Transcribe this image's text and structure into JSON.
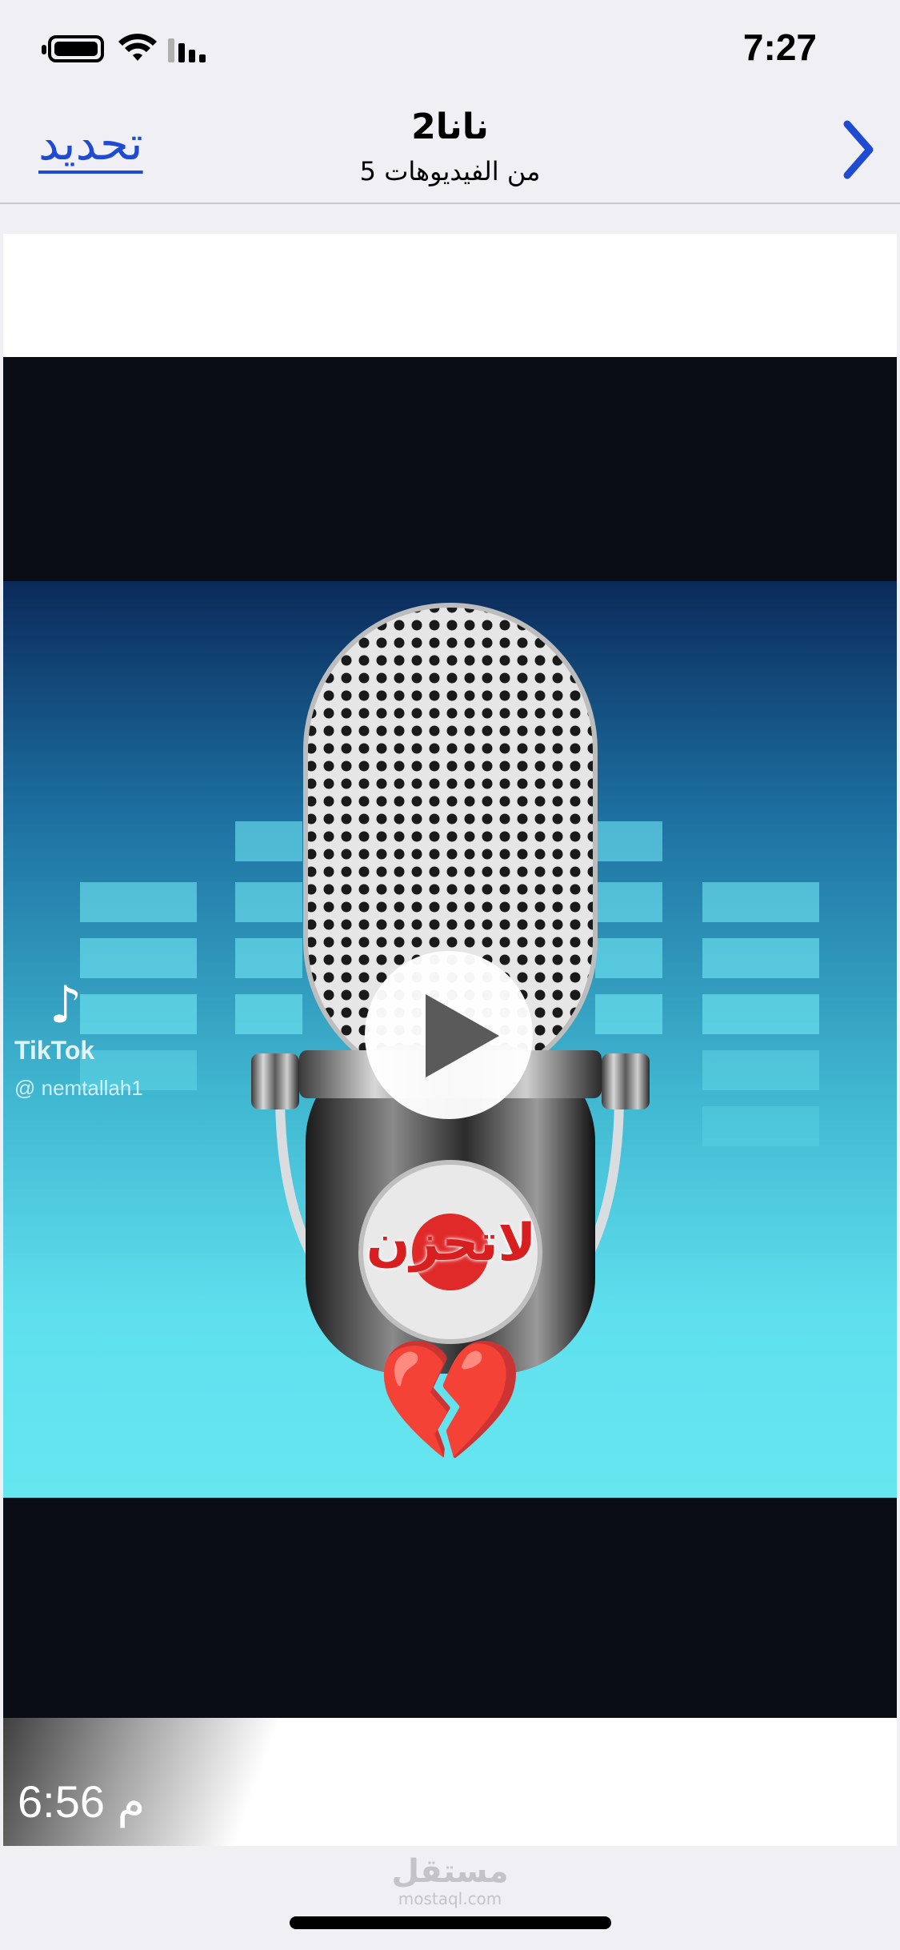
{
  "status_bar": {
    "time": "7:27",
    "icons": [
      "battery-icon",
      "wifi-icon",
      "cellular-signal-icon"
    ]
  },
  "nav": {
    "left_action": "تحديد",
    "title": "نانا2",
    "subtitle": "5 من الفيديوهات",
    "right_icon": "chevron-right-icon",
    "accent_color": "#1e4bd2"
  },
  "video": {
    "watermark_app": "TikTok",
    "watermark_user": "@ nemtallah1",
    "overlay_text": "لاتحزن",
    "heart_emoji": "💔",
    "play_icon": "play-icon",
    "timestamp": "6:56 م"
  },
  "footer": {
    "watermark_ar": "مستقل",
    "watermark_en": "mostaql.com"
  }
}
